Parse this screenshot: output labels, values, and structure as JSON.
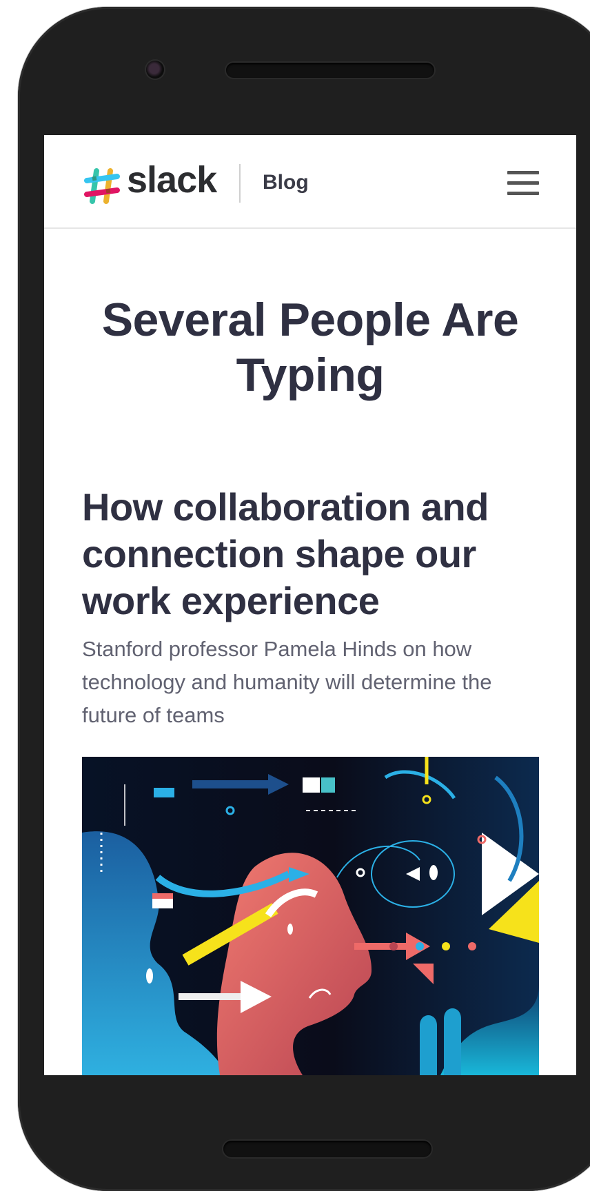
{
  "header": {
    "brand": "slack",
    "section_label": "Blog",
    "menu_icon": "hamburger-menu-icon"
  },
  "blog": {
    "title": "Several People Are Typing"
  },
  "article": {
    "title": "How collaboration and connection shape our work experience",
    "subtitle": "Stanford professor Pamela Hinds on how technology and humanity will determine the future of teams",
    "image": "illustration of abstract human profiles facing each other with arrows and geometric shapes"
  },
  "colors": {
    "phone_body": "#1f1f1f",
    "heading": "#2f3042",
    "subtext": "#616271",
    "logo_teal": "#36c5ab",
    "logo_yellow": "#ecb22e",
    "logo_pink": "#e01563",
    "logo_blue": "#36c5f0"
  }
}
